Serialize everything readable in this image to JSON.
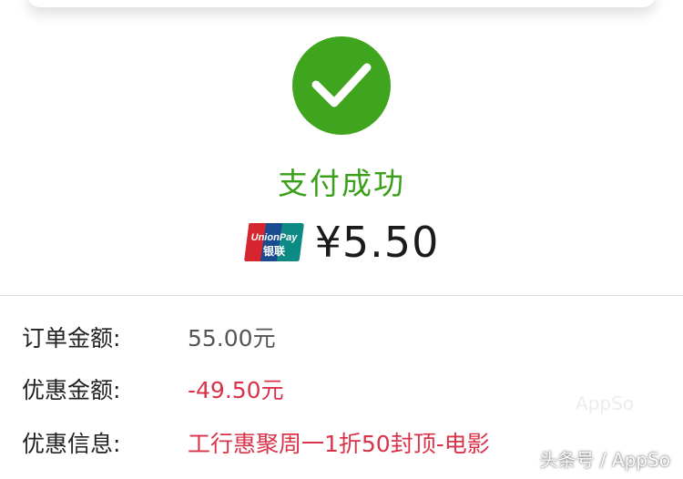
{
  "status": {
    "title": "支付成功",
    "icon": "checkmark-icon",
    "color": "#40a51e"
  },
  "payment": {
    "logo_text_top": "UnionPay",
    "logo_text_bottom": "银联",
    "amount": "¥5.50"
  },
  "details": [
    {
      "label": "订单金额:",
      "value": "55.00元",
      "color": "#555555"
    },
    {
      "label": "优惠金额:",
      "value": "-49.50元",
      "color": "#d9334a"
    },
    {
      "label": "优惠信息:",
      "value": "工行惠聚周一1折50封顶-电影",
      "color": "#d9334a"
    }
  ],
  "watermark": "头条号 / AppSo",
  "ghost_watermark": "AppSo"
}
